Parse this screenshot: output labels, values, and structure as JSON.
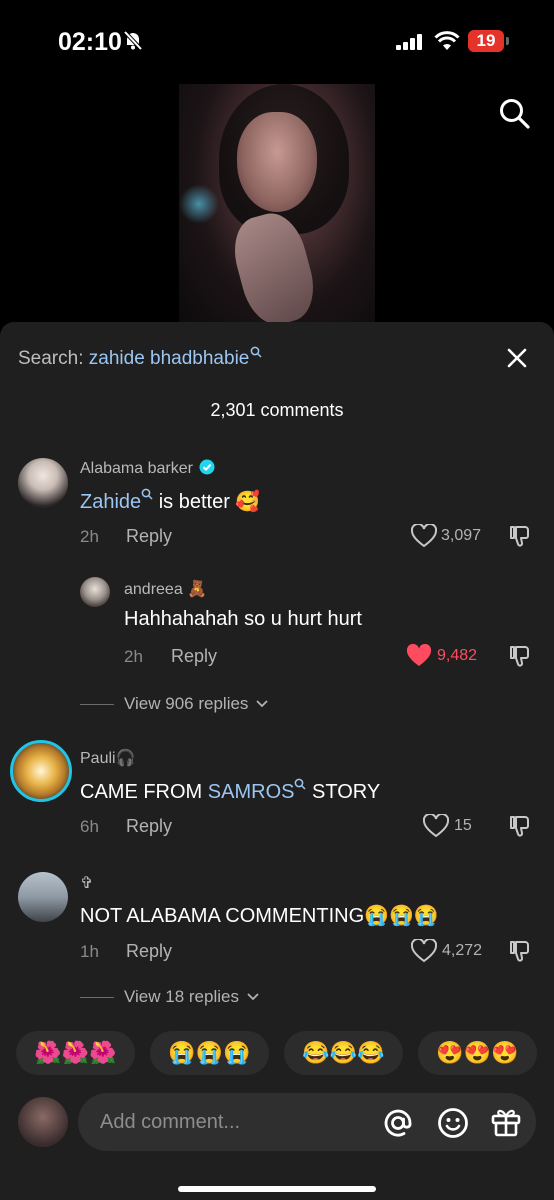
{
  "status": {
    "time": "02:10",
    "battery": "19"
  },
  "search_bar": {
    "prefix": "Search: ",
    "query": "zahide bhadbhabie"
  },
  "comments_count": "2,301 comments",
  "comments": [
    {
      "username": "Alabama barker",
      "link_text": "Zahide",
      "text": " is better 🥰",
      "time": "2h",
      "reply": "Reply",
      "likes": "3,097"
    },
    {
      "username": "andreea 🧸",
      "text": "Hahhahahah so u hurt hurt",
      "time": "2h",
      "reply": "Reply",
      "likes": "9,482"
    },
    {
      "username": "Pauli🎧",
      "text_pre": "CAME FROM ",
      "link_text": "SAMROS",
      "text_post": " STORY",
      "time": "6h",
      "reply": "Reply",
      "likes": "15"
    },
    {
      "username": "✞",
      "text": "NOT ALABAMA COMMENTING😭😭😭",
      "time": "1h",
      "reply": "Reply",
      "likes": "4,272"
    }
  ],
  "view_replies": [
    "View 906 replies",
    "View 18 replies"
  ],
  "quick_emojis": [
    "🌺🌺🌺",
    "😭😭😭",
    "😂😂😂",
    "😍😍😍"
  ],
  "comment_input": {
    "placeholder": "Add comment..."
  },
  "colors": {
    "sheet": "#1f1f1f",
    "link": "#9cc6f2",
    "liked": "#ff4b5f",
    "verified": "#20d5ec"
  },
  "icons": [
    "bell-slash-icon",
    "signal-icon",
    "wifi-icon",
    "search-icon",
    "close-icon",
    "verified-icon",
    "heart-icon",
    "dislike-icon",
    "chevron-down-icon",
    "mention-icon",
    "emoji-icon",
    "gift-icon"
  ]
}
